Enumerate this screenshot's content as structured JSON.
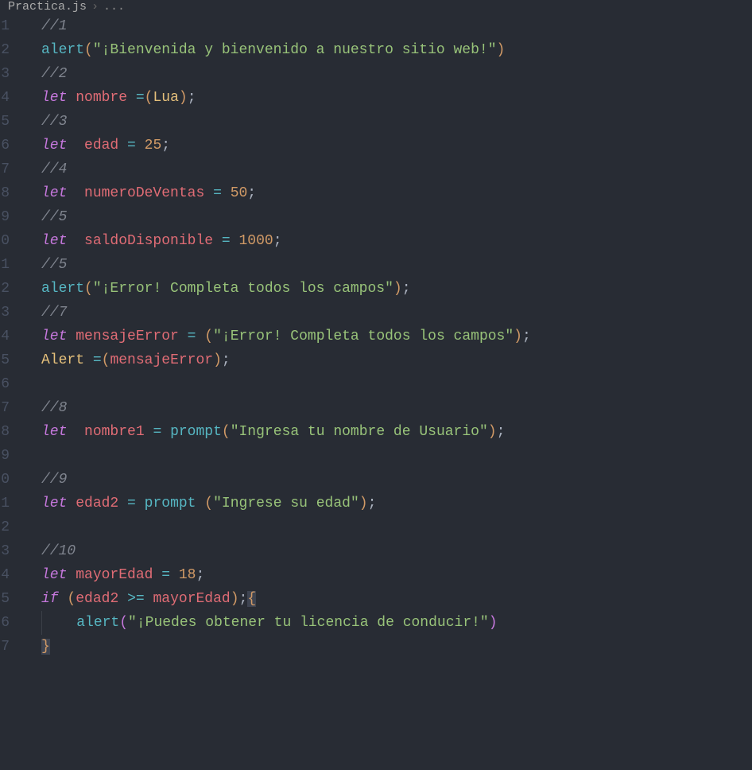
{
  "breadcrumb": {
    "file": "Practica.js",
    "separator": "›",
    "rest": "..."
  },
  "lineNumbers": [
    "1",
    "2",
    "3",
    "4",
    "5",
    "6",
    "7",
    "8",
    "9",
    "0",
    "1",
    "2",
    "3",
    "4",
    "5",
    "6",
    "7",
    "8",
    "9",
    "0",
    "1",
    "2",
    "3",
    "4",
    "5",
    "6",
    "7"
  ],
  "code": {
    "c1": "//1",
    "alert1_fn": "alert",
    "alert1_str": "\"¡Bienvenida y bienvenido a nuestro sitio web!\"",
    "c2": "//2",
    "let": "let",
    "nombre": "nombre",
    "eq": "=",
    "lua": "Lua",
    "semi": ";",
    "c3": "//3",
    "edad": "edad",
    "n25": "25",
    "c4": "//4",
    "numeroDeVentas": "numeroDeVentas",
    "n50": "50",
    "c5": "//5",
    "saldoDisponible": "saldoDisponible",
    "n1000": "1000",
    "c5b": "//5",
    "alert2_str": "\"¡Error! Completa todos los campos\"",
    "c7": "//7",
    "mensajeError": "mensajeError",
    "err_str": "\"¡Error! Completa todos los campos\"",
    "Alert": "Alert",
    "c8": "//8",
    "nombre1": "nombre1",
    "prompt": "prompt",
    "prompt1_str": "\"Ingresa tu nombre de Usuario\"",
    "c9": "//9",
    "edad2": "edad2",
    "prompt2_str": "\"Ingrese su edad\"",
    "c10": "//10",
    "mayorEdad": "mayorEdad",
    "n18": "18",
    "if": "if",
    "gte": ">=",
    "lbrace": "{",
    "rbrace": "}",
    "alert3_str": "\"¡Puedes obtener tu licencia de conducir!\"",
    "lparen": "(",
    "rparen": ")"
  }
}
